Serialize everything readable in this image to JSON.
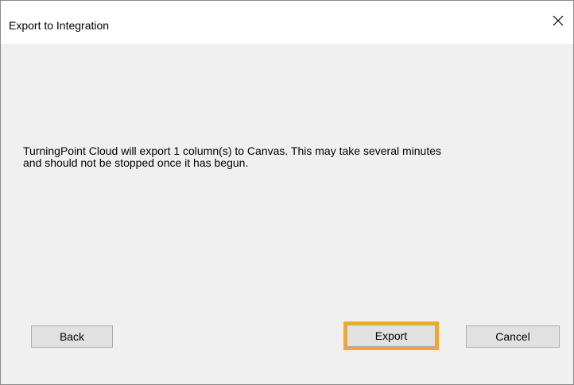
{
  "window": {
    "title": "Export to Integration",
    "close_icon": "close-icon"
  },
  "body": {
    "message": "TurningPoint Cloud will export 1 column(s) to Canvas. This may take several minutes\nand should not be stopped once it has begun."
  },
  "buttons": {
    "back_label": "Back",
    "export_label": "Export",
    "cancel_label": "Cancel"
  },
  "colors": {
    "dialog_background": "#f0f0f0",
    "titlebar_background": "#ffffff",
    "button_background": "#e1e1e1",
    "button_border": "#adadad",
    "highlight": "#f5a623"
  }
}
